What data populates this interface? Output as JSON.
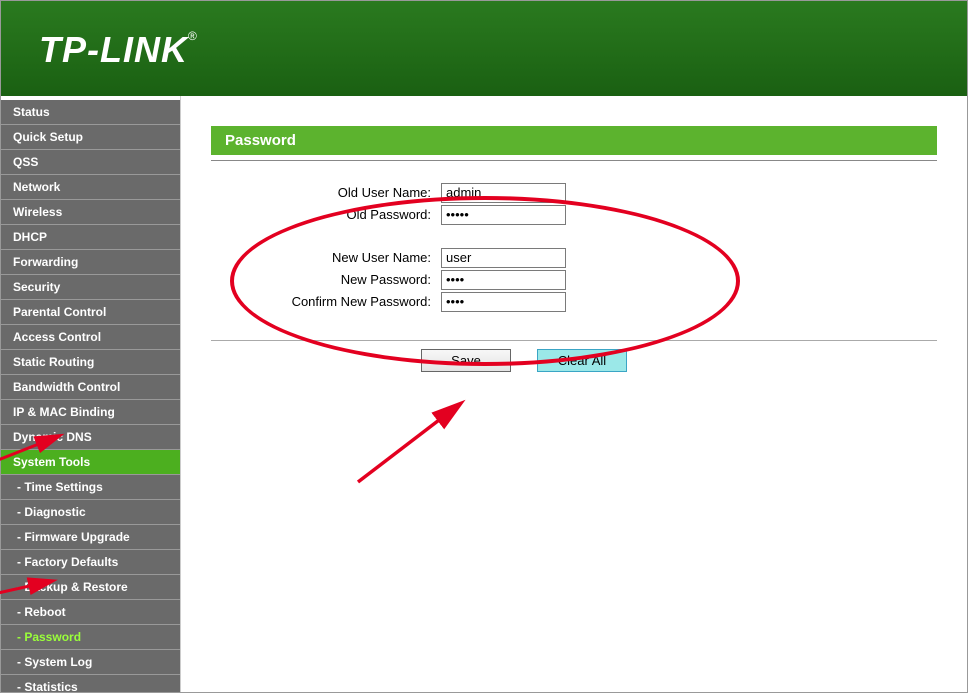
{
  "brand": "TP-LINK",
  "sidebar": {
    "items": [
      {
        "label": "Status"
      },
      {
        "label": "Quick Setup"
      },
      {
        "label": "QSS"
      },
      {
        "label": "Network"
      },
      {
        "label": "Wireless"
      },
      {
        "label": "DHCP"
      },
      {
        "label": "Forwarding"
      },
      {
        "label": "Security"
      },
      {
        "label": "Parental Control"
      },
      {
        "label": "Access Control"
      },
      {
        "label": "Static Routing"
      },
      {
        "label": "Bandwidth Control"
      },
      {
        "label": "IP & MAC Binding"
      },
      {
        "label": "Dynamic DNS"
      },
      {
        "label": "System Tools",
        "active": true
      }
    ],
    "subitems": [
      {
        "label": "- Time Settings"
      },
      {
        "label": "- Diagnostic"
      },
      {
        "label": "- Firmware Upgrade"
      },
      {
        "label": "- Factory Defaults"
      },
      {
        "label": "- Backup & Restore"
      },
      {
        "label": "- Reboot"
      },
      {
        "label": "- Password",
        "selected": true
      },
      {
        "label": "- System Log"
      },
      {
        "label": "- Statistics"
      }
    ]
  },
  "panel": {
    "title": "Password",
    "fields": {
      "old_user_label": "Old User Name:",
      "old_user_value": "admin",
      "old_pass_label": "Old Password:",
      "old_pass_value": "•••••",
      "new_user_label": "New User Name:",
      "new_user_value": "user",
      "new_pass_label": "New Password:",
      "new_pass_value": "••••",
      "confirm_label": "Confirm New Password:",
      "confirm_value": "••••"
    },
    "buttons": {
      "save": "Save",
      "clear": "Clear All"
    }
  }
}
